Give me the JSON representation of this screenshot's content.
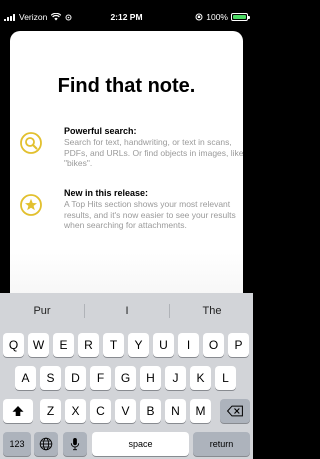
{
  "status_bar": {
    "carrier": "Verizon",
    "time": "2:12 PM",
    "battery": "100%",
    "battery_level": 1.0
  },
  "sheet": {
    "title": "Find that note.",
    "features": [
      {
        "title": "Powerful search:",
        "description": "Search for text, handwriting, or text in scans, PDFs, and URLs. Or find objects in images, like \"bikes\".",
        "icon": "magnifier-icon"
      },
      {
        "title": "New in this release:",
        "description": "A Top Hits section shows your most relevant results, and it's now easier to see your results when searching for attachments.",
        "icon": "star-icon"
      }
    ],
    "accent_color": "#e2c02e"
  },
  "keyboard": {
    "suggestions": [
      "Pur",
      "I",
      "The"
    ],
    "row1": [
      "Q",
      "W",
      "E",
      "R",
      "T",
      "Y",
      "U",
      "I",
      "O",
      "P"
    ],
    "row2": [
      "A",
      "S",
      "D",
      "F",
      "G",
      "H",
      "J",
      "K",
      "L"
    ],
    "row3": [
      "Z",
      "X",
      "C",
      "V",
      "B",
      "N",
      "M"
    ],
    "numbers_label": "123",
    "space_label": "space",
    "return_label": "return"
  }
}
